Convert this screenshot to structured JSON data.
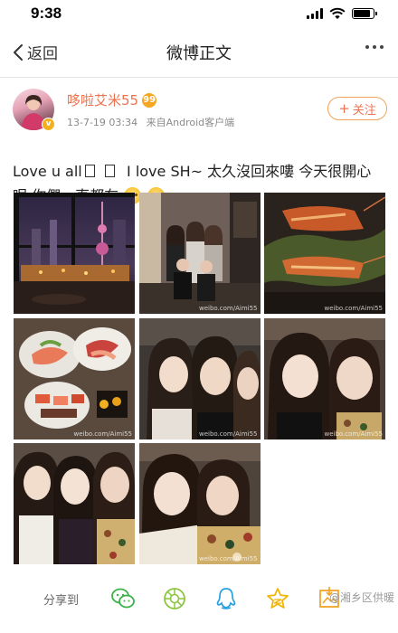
{
  "status_bar": {
    "time": "9:38"
  },
  "nav": {
    "back_label": "返回",
    "title": "微博正文"
  },
  "post": {
    "user_name": "哆啦艾米55",
    "level_badge": "99",
    "verify_badge": "v",
    "time": "13-7-19 03:34",
    "source": "来自Android客户端",
    "follow_label": "关注",
    "text_part1": "Love u all",
    "text_part2": "I love SH~ 太久沒回來嘍 今天很開心呢 你們一直都在"
  },
  "photos": [
    {
      "name": "photo-city-night",
      "watermark": ""
    },
    {
      "name": "photo-group-room",
      "watermark": "weibo.com/Aimi55"
    },
    {
      "name": "photo-lobster",
      "watermark": "weibo.com/Aimi55"
    },
    {
      "name": "photo-sashimi",
      "watermark": "weibo.com/Aimi55"
    },
    {
      "name": "photo-selfie-three",
      "watermark": "weibo.com/Aimi55"
    },
    {
      "name": "photo-selfie-two",
      "watermark": "weibo.com/Aimi55"
    },
    {
      "name": "photo-three-girls",
      "watermark": ""
    },
    {
      "name": "photo-hug-two",
      "watermark": "weibo.com/Aimi55"
    }
  ],
  "share": {
    "label": "分享到",
    "watermark": "@湘乡区供暖",
    "icons": [
      "wechat-icon",
      "moments-icon",
      "qq-icon",
      "qzone-icon",
      "save-image-icon"
    ]
  },
  "colors": {
    "accent": "#eb7350",
    "follow_border": "#f0a35a",
    "share_green": "#3bb24a"
  }
}
